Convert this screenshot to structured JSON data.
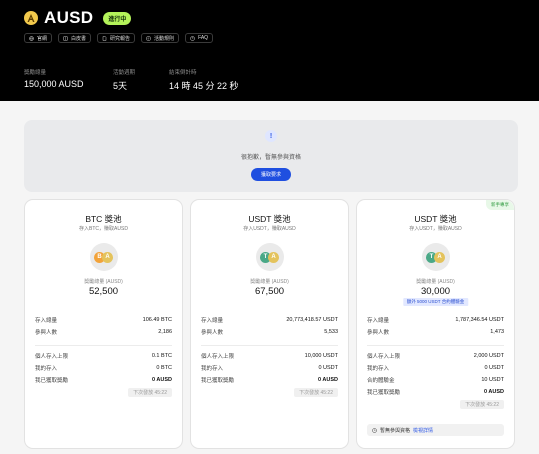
{
  "header": {
    "title": "AUSD",
    "status": "進行中",
    "links": [
      {
        "label": "官網",
        "icon": "globe-icon"
      },
      {
        "label": "白皮書",
        "icon": "book-icon"
      },
      {
        "label": "研究報告",
        "icon": "document-icon"
      },
      {
        "label": "活動規則",
        "icon": "rules-icon"
      },
      {
        "label": "FAQ",
        "icon": "help-icon"
      }
    ],
    "stats": [
      {
        "label": "獎勵總量",
        "value": "150,000 AUSD"
      },
      {
        "label": "活動週期",
        "value": "5天"
      },
      {
        "label": "結束倒計時",
        "value": "14 時 45 分 22 秒"
      }
    ]
  },
  "notice": {
    "icon": "!",
    "message": "很抱歉，暫無參與資格",
    "button": "獲取要求"
  },
  "pools": [
    {
      "name": "BTC 獎池",
      "subtitle": "存入BTC，賺取AUSD",
      "coin_a": "B",
      "coin_b": "A",
      "pool_label": "獎勵總量 (AUSD)",
      "pool_value": "52,500",
      "stats": [
        {
          "k": "存入總量",
          "v": "106.49 BTC"
        },
        {
          "k": "參與人數",
          "v": "2,186"
        }
      ],
      "limits": [
        {
          "k": "個人存入上限",
          "v": "0.1 BTC"
        },
        {
          "k": "我的存入",
          "v": "0 BTC"
        },
        {
          "k": "我已獲取獎勵",
          "v": "0 AUSD"
        }
      ],
      "next": "下次發放 45:22"
    },
    {
      "name": "USDT 獎池",
      "subtitle": "存入USDT，賺取AUSD",
      "coin_a": "T",
      "coin_b": "A",
      "pool_label": "獎勵總量 (AUSD)",
      "pool_value": "67,500",
      "stats": [
        {
          "k": "存入總量",
          "v": "20,773,418.57 USDT"
        },
        {
          "k": "參與人數",
          "v": "5,533"
        }
      ],
      "limits": [
        {
          "k": "個人存入上限",
          "v": "10,000 USDT"
        },
        {
          "k": "我的存入",
          "v": "0 USDT"
        },
        {
          "k": "我已獲取獎勵",
          "v": "0 AUSD"
        }
      ],
      "next": "下次發放 45:22"
    },
    {
      "name": "USDT 獎池",
      "subtitle": "存入USDT，賺取AUSD",
      "corner": "新手專享",
      "coin_a": "T",
      "coin_b": "A",
      "pool_label": "獎勵總量 (AUSD)",
      "pool_value": "30,000",
      "bonus": "額外 5000 USDT 合約體驗金",
      "stats": [
        {
          "k": "存入總量",
          "v": "1,787,346.54 USDT"
        },
        {
          "k": "參與人數",
          "v": "1,473"
        }
      ],
      "limits": [
        {
          "k": "個人存入上限",
          "v": "2,000 USDT"
        },
        {
          "k": "我的存入",
          "v": "0 USDT"
        },
        {
          "k": "合約體驗金",
          "v": "10 USDT"
        },
        {
          "k": "我已獲取獎勵",
          "v": "0 AUSD"
        }
      ],
      "next": "下次發放 45:22",
      "foot": {
        "text": "暫無參與資格",
        "link": "檢視詳情"
      }
    }
  ],
  "colors": {
    "accent": "#1f4fe0",
    "status": "#b4f35a",
    "header_bg": "#000000"
  }
}
